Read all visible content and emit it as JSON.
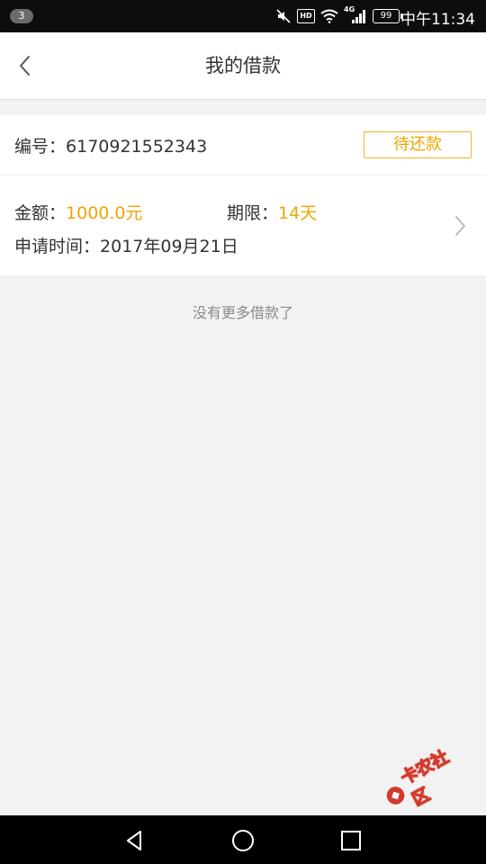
{
  "status_bar": {
    "notification_count": "3",
    "hd_label": "HD",
    "network_label": "4G",
    "battery_level": "99",
    "time": "中午11:34",
    "icons": [
      "mute-icon",
      "hd-icon",
      "wifi-icon",
      "signal-icon",
      "battery-icon"
    ]
  },
  "header": {
    "title": "我的借款",
    "back_icon": "chevron-left-icon"
  },
  "loan": {
    "id_label": "编号：",
    "id_value": "6170921552343",
    "status": "待还款",
    "amount_label": "金额：",
    "amount_value": "1000.0元",
    "term_label": "期限：",
    "term_value": "14天",
    "date_label": "申请时间：",
    "date_value": "2017年09月21日"
  },
  "list_footer": "没有更多借款了",
  "watermark": "卡农社区",
  "nav_bar": [
    "back-triangle-icon",
    "home-circle-icon",
    "recent-square-icon"
  ],
  "colors": {
    "accent": "#f0a500",
    "background": "#f2f2f2",
    "card": "#ffffff",
    "status_bar": "#0d0d0d",
    "nav_bar": "#000000"
  }
}
